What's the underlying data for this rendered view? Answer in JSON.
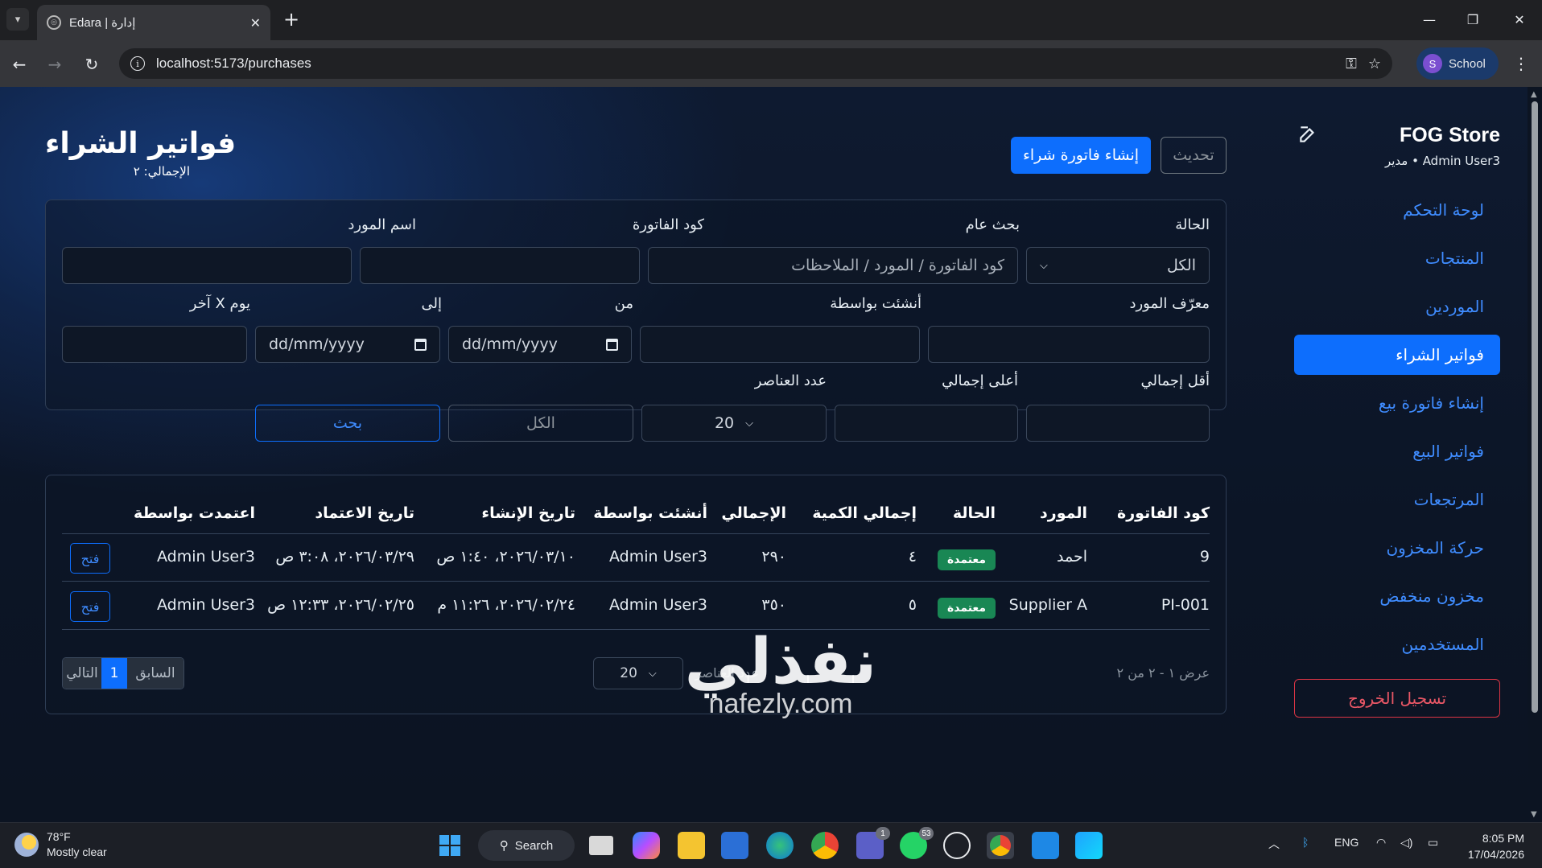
{
  "browser": {
    "tab_title": "Edara | إدارة",
    "url": "localhost:5173/purchases",
    "profile_initial": "S",
    "profile_name": "School"
  },
  "sidebar": {
    "brand": "FOG Store",
    "user_line": "Admin User3 • مدير",
    "items": [
      {
        "label": "لوحة التحكم",
        "active": false
      },
      {
        "label": "المنتجات",
        "active": false
      },
      {
        "label": "الموردين",
        "active": false
      },
      {
        "label": "فواتير الشراء",
        "active": true
      },
      {
        "label": "إنشاء فاتورة بيع",
        "active": false
      },
      {
        "label": "فواتير البيع",
        "active": false
      },
      {
        "label": "المرتجعات",
        "active": false
      },
      {
        "label": "حركة المخزون",
        "active": false
      },
      {
        "label": "مخزون منخفض",
        "active": false
      },
      {
        "label": "المستخدمين",
        "active": false
      }
    ],
    "logout": "تسجيل الخروج"
  },
  "header": {
    "title": "فواتير الشراء",
    "total": "الإجمالي: ٢",
    "create_button": "إنشاء فاتورة شراء",
    "refresh_button": "تحديث"
  },
  "filters": {
    "status_label": "الحالة",
    "status_value": "الكل",
    "search_label": "بحث عام",
    "search_placeholder": "كود الفاتورة / المورد / الملاحظات",
    "invoice_code_label": "كود الفاتورة",
    "supplier_name_label": "اسم المورد",
    "supplier_id_label": "معرّف المورد",
    "created_by_label": "أنشئت بواسطة",
    "from_label": "من",
    "from_placeholder": "dd/mm/yyyy",
    "to_label": "إلى",
    "to_placeholder": "dd/mm/yyyy",
    "last_days_label": "آخر X يوم",
    "min_total_label": "أقل إجمالي",
    "max_total_label": "أعلى إجمالي",
    "page_size_label": "عدد العناصر",
    "page_size_value": "20",
    "reset_button": "الكل",
    "search_button": "بحث"
  },
  "table": {
    "columns": [
      "كود الفاتورة",
      "المورد",
      "الحالة",
      "إجمالي الكمية",
      "الإجمالي",
      "أنشئت بواسطة",
      "تاريخ الإنشاء",
      "تاريخ الاعتماد",
      "اعتمدت بواسطة"
    ],
    "rows": [
      {
        "code": "9",
        "supplier": "احمد",
        "status": "معتمدة",
        "qty": "٤",
        "total": "٢٩٠",
        "created_by": "Admin User3",
        "created_at": "٢٠٢٦/٠٣/١٠، ١:٤٠ ص",
        "approved_at": "٢٠٢٦/٠٣/٢٩، ٣:٠٨ ص",
        "approved_by": "Admin User3",
        "action": "فتح"
      },
      {
        "code": "PI-001",
        "supplier": "Supplier A",
        "status": "معتمدة",
        "qty": "٥",
        "total": "٣٥٠",
        "created_by": "Admin User3",
        "created_at": "٢٠٢٦/٠٢/٢٤، ١١:٢٦ م",
        "approved_at": "٢٠٢٦/٠٢/٢٥، ١٢:٣٣ ص",
        "approved_by": "Admin User3",
        "action": "فتح"
      }
    ],
    "showing": "عرض ١ - ٢ من ٢",
    "page_size_label": "عدد العناصر",
    "page_size_value": "20",
    "prev": "السابق",
    "current_page": "1",
    "next": "التالي"
  },
  "watermark": {
    "main": "نفذلي",
    "sub": "nafezly.com"
  },
  "taskbar": {
    "temperature": "78°F",
    "weather": "Mostly clear",
    "search": "Search",
    "language": "ENG",
    "time": "8:05 PM",
    "date": "17/04/2026",
    "teams_badge": "1",
    "whatsapp_badge": "53"
  },
  "colors": {
    "accent": "#0d6efd",
    "success": "#198754",
    "danger": "#dc3545"
  }
}
